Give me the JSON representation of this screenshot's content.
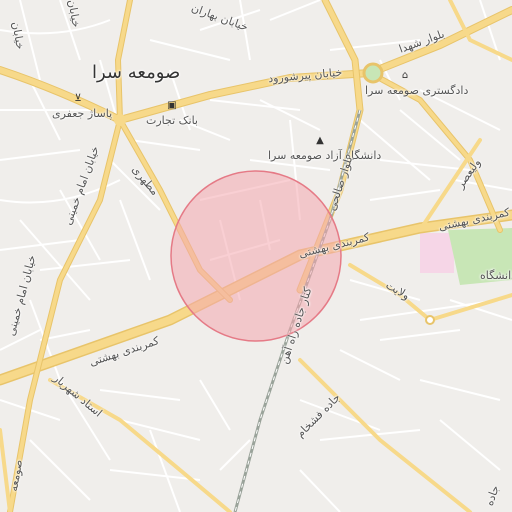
{
  "map": {
    "city_label": "صومعه سرا",
    "places": {
      "courthouse": "دادگستری صومعه سرا",
      "university": "دانشگاه آزاد صومعه سرا",
      "bank": "بانک تجارت",
      "passage": "پاساژ جعفری",
      "university_right": "دانشگاه"
    },
    "streets": {
      "boulevard_shohada": "بلوار شهدا",
      "khiaban_pirsharud": "خیابان پیرشورود",
      "boulevard_salehi": "بلوار صالحی",
      "beltway_beheshti_main": "کمربندی بهشتی",
      "beltway_beheshti_left": "کمربندی بهشتی",
      "beltway_beheshti_right": "کمربندی بهشتی",
      "railway": "کنار جاده راه آهن",
      "jade_fashkham": "جاده فشخام",
      "ostad_shahriar": "استاد شهریار",
      "emam_khomeini": "خیابان امام خمینی",
      "emam_khomeini_2": "خیابان امام خمینی",
      "motahari": "مطهری",
      "velayat": "ولایت",
      "valiasr": "ولیعصر",
      "top_left_1": "خیابان",
      "top_left_2": "خیابان",
      "top_mid": "خیابان بهاران",
      "bottom_left": "صومعه",
      "bottom_right": "جاده"
    },
    "icons": {
      "courthouse": "museum-icon",
      "university": "graduation-cap-icon",
      "bank": "bank-icon",
      "shop": "shopping-cart-icon"
    },
    "colors": {
      "background": "#f0eeeb",
      "road_major": "#f7d98a",
      "road_major_edge": "#e8c46a",
      "road_minor": "#ffffff",
      "park": "#c8e6b6",
      "pink_area": "#f6d6e7",
      "highlight_fill": "#f4a7ae",
      "highlight_stroke": "#e57a86",
      "railway": "#9aa39a"
    }
  }
}
